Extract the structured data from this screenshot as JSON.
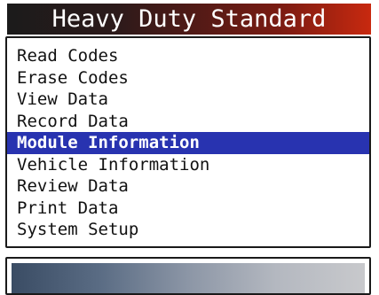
{
  "header": {
    "title": "Heavy Duty Standard"
  },
  "menu": {
    "selected_index": 4,
    "items": [
      {
        "label": "Read Codes"
      },
      {
        "label": "Erase Codes"
      },
      {
        "label": "View Data"
      },
      {
        "label": "Record Data"
      },
      {
        "label": "Module Information"
      },
      {
        "label": "Vehicle Information"
      },
      {
        "label": "Review Data"
      },
      {
        "label": "Print Data"
      },
      {
        "label": "System Setup"
      }
    ]
  },
  "colors": {
    "selection": "#2833b0",
    "title_gradient_end": "#c8290f",
    "status_gradient_start": "#3a4c64"
  }
}
